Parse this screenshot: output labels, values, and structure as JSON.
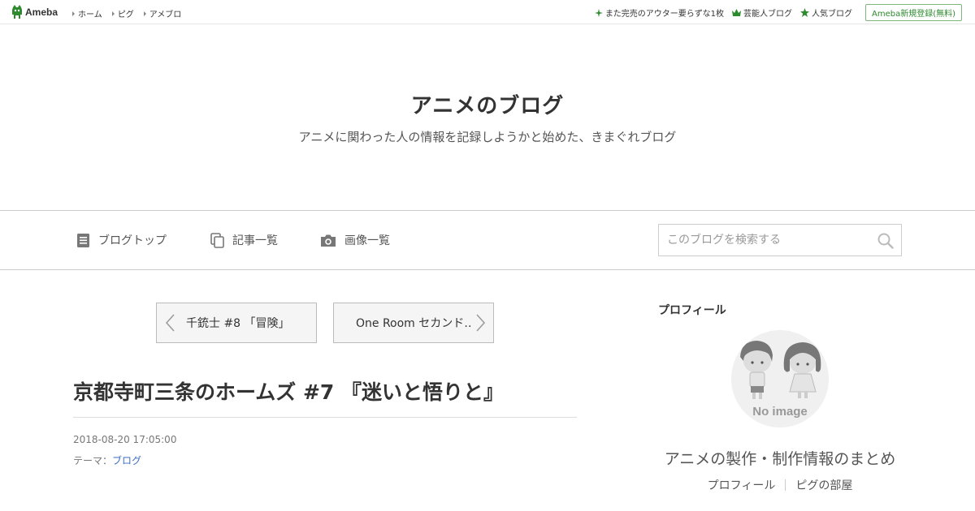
{
  "topbar": {
    "logo_label": "Ameba",
    "nav": [
      {
        "label": "ホーム"
      },
      {
        "label": "ピグ"
      },
      {
        "label": "アメブロ"
      }
    ],
    "right_links": [
      {
        "label": "また完売のアウター要らずな1枚",
        "icon": "sparkle-icon"
      },
      {
        "label": "芸能人ブログ",
        "icon": "crown-icon"
      },
      {
        "label": "人気ブログ",
        "icon": "star-icon"
      }
    ],
    "register_label": "Ameba新規登録(無料)"
  },
  "header": {
    "title": "アニメのブログ",
    "description": "アニメに関わった人の情報を記録しようかと始めた、きまぐれブログ"
  },
  "nav": {
    "items": [
      {
        "label": "ブログトップ",
        "icon": "document-icon"
      },
      {
        "label": "記事一覧",
        "icon": "copy-icon"
      },
      {
        "label": "画像一覧",
        "icon": "camera-icon"
      }
    ],
    "search_placeholder": "このブログを検索する"
  },
  "pager": {
    "prev_label": "千銃士 #8 「冒険」",
    "next_label": "One Room セカンド…"
  },
  "article": {
    "title": "京都寺町三条のホームズ #7 『迷いと悟りと』",
    "date": "2018-08-20 17:05:00",
    "theme_prefix": "テーマ：",
    "theme_link": "ブログ"
  },
  "sidebar": {
    "heading": "プロフィール",
    "avatar_text": "No image",
    "profile_name": "アニメの製作・制作情報のまとめ",
    "links": [
      {
        "label": "プロフィール"
      },
      {
        "label": "ピグの部屋"
      }
    ]
  },
  "colors": {
    "brand_green": "#2d8a2d",
    "link_blue": "#3b6dbf",
    "border": "#cccccc"
  }
}
